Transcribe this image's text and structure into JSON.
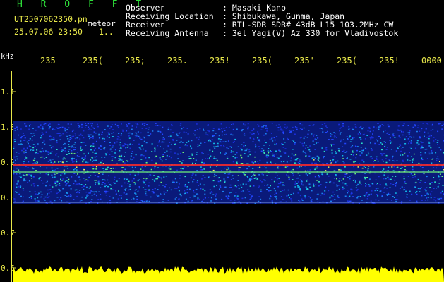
{
  "header": {
    "brand": "H R O F F T",
    "filename": "UT2507062350.pn",
    "meteor_label": "meteor",
    "datetime": "25.07.06 23:50",
    "counter": "1..",
    "fields": [
      {
        "label": "Observer",
        "value": ": Masaki Kano"
      },
      {
        "label": "Receiving Location",
        "value": ": Shibukawa, Gunma, Japan"
      },
      {
        "label": "Receiver",
        "value": ": RTL-SDR SDR# 43dB L15 103.2MHz CW"
      },
      {
        "label": "Receiving Antenna",
        "value": ": 3el Yagi(V) Az 330 for Vladivostok"
      }
    ]
  },
  "axis": {
    "unit": "kHz",
    "y_ticks": [
      "1.1",
      "1.0",
      "0.9",
      "0.8",
      "0.7",
      "0.6"
    ],
    "x_ticks": [
      "235",
      "235(",
      "235;",
      "235.",
      "235!",
      "235(",
      "235'",
      "235(",
      "235!",
      "0000"
    ]
  },
  "colors": {
    "label_yellow": "#e8e84a",
    "brand_green": "#2ee03a",
    "echo_red": "#ff2a2a",
    "band_blue": "#1e3fff",
    "baseline_yellow": "#ffff00"
  }
}
